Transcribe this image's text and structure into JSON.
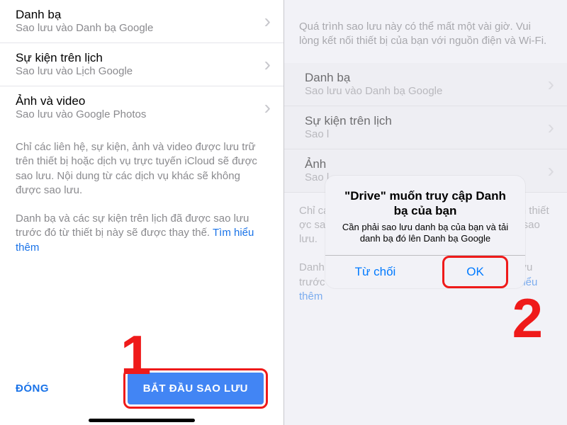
{
  "left": {
    "items": [
      {
        "title": "Danh bạ",
        "sub": "Sao lưu vào Danh bạ Google"
      },
      {
        "title": "Sự kiện trên lịch",
        "sub": "Sao lưu vào Lịch Google"
      },
      {
        "title": "Ảnh và video",
        "sub": "Sao lưu vào Google Photos"
      }
    ],
    "info1": "Chỉ các liên hệ, sự kiện, ảnh và video được lưu trữ trên thiết bị hoặc dịch vụ trực tuyến iCloud sẽ được sao lưu. Nội dung từ các dịch vụ khác sẽ không được sao lưu.",
    "info2a": "Danh bạ và các sự kiện trên lịch đã được sao lưu trước đó từ thiết bị này sẽ được thay thế. ",
    "info2_link": "Tìm hiểu thêm",
    "close_label": "ĐÓNG",
    "start_label": "BẮT ĐẦU SAO LƯU"
  },
  "right": {
    "intro": "Quá trình sao lưu này có thể mất một vài giờ. Vui lòng kết nối thiết bị của bạn với nguồn điện và Wi-Fi.",
    "items": [
      {
        "title": "Danh bạ",
        "sub": "Sao lưu vào Danh bạ Google"
      },
      {
        "title": "Sự kiện trên lịch",
        "sub": "Sao l"
      },
      {
        "title": "Ảnh",
        "sub": "Sao l"
      }
    ],
    "info1": "Chỉ các                                                      rữ trên thiết                                                     ợc sao lưu.                                                được sao lưu.",
    "info2a": "Danh bạ và các sự kiện trên lịch đã được sao lưu trước đó từ thiết bị này sẽ được thay thế. ",
    "info2_link": "Tìm hiểu thêm"
  },
  "alert": {
    "title": "\"Drive\" muốn truy cập Danh bạ của bạn",
    "message": "Cần phải sao lưu danh bạ của bạn và tải danh bạ đó lên Danh bạ Google",
    "deny": "Từ chối",
    "ok": "OK"
  },
  "annotations": {
    "one": "1",
    "two": "2"
  }
}
